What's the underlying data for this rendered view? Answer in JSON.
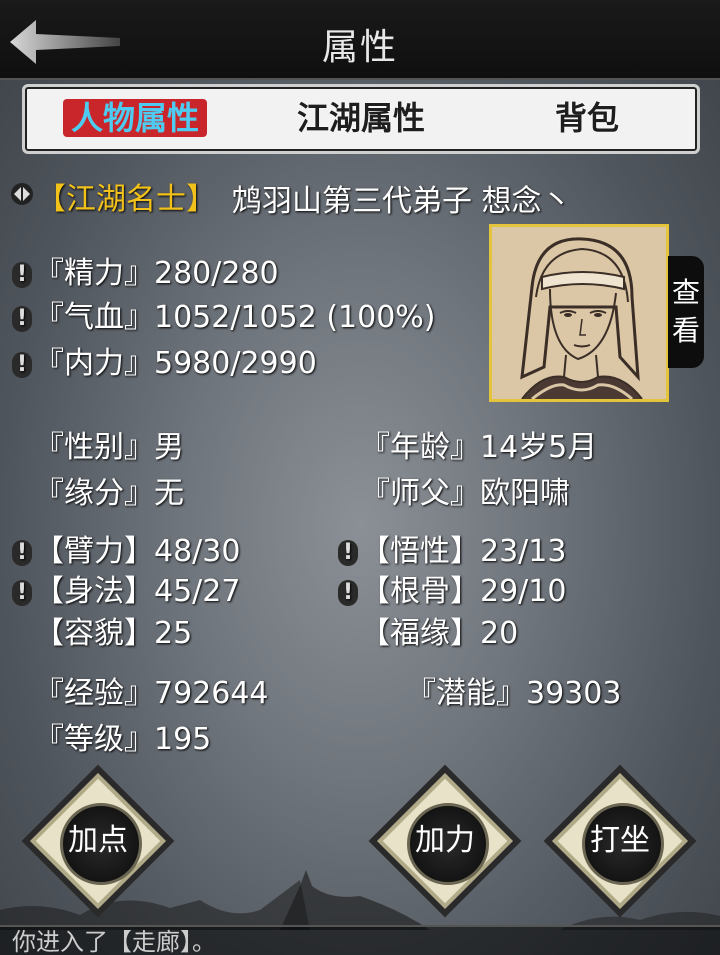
{
  "header": {
    "title": "属性"
  },
  "tabs": [
    {
      "label": "人物属性",
      "active": true
    },
    {
      "label": "江湖属性",
      "active": false
    },
    {
      "label": "背包",
      "active": false
    }
  ],
  "character": {
    "rank": "【江湖名士】",
    "name": "鸩羽山第三代弟子 想念丶"
  },
  "vitals": {
    "energy": "『精力』280/280",
    "health": "『气血』1052/1052 (100%)",
    "inner": "『内力』5980/2990"
  },
  "portrait": {
    "view_label": "查看"
  },
  "info": {
    "gender": "『性别』男",
    "age": "『年龄』14岁5月",
    "fate": "『缘分』无",
    "master": "『师父』欧阳啸"
  },
  "stats": {
    "strength": "【臂力】48/30",
    "comprehension": "【悟性】23/13",
    "agility": "【身法】45/27",
    "constitution": "【根骨】29/10",
    "looks": "【容貌】25",
    "luck": "【福缘】20"
  },
  "progress": {
    "exp": "『经验』792644",
    "potential": "『潜能』39303",
    "level": "『等级』195"
  },
  "actions": {
    "add_points": "加点",
    "add_force": "加力",
    "meditate": "打坐"
  },
  "log": {
    "text": "你进入了【走廊】。"
  }
}
